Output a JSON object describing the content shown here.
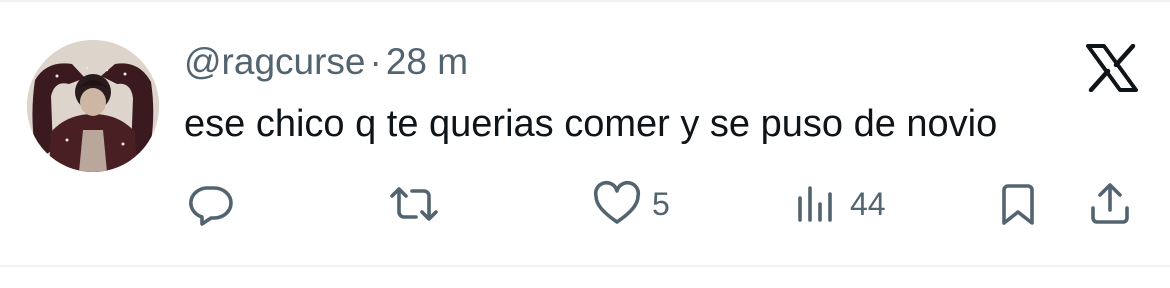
{
  "tweet": {
    "handle": "@ragcurse",
    "separator": "·",
    "time": "28 m",
    "text": "ese chico q te querias comer y se puso de novio"
  },
  "actions": {
    "reply": {
      "icon": "reply-icon"
    },
    "retweet": {
      "icon": "retweet-icon"
    },
    "like": {
      "icon": "heart-icon",
      "count": "5"
    },
    "views": {
      "icon": "views-icon",
      "count": "44"
    },
    "bookmark": {
      "icon": "bookmark-icon"
    },
    "share": {
      "icon": "share-icon"
    }
  },
  "colors": {
    "text_primary": "#0f1419",
    "text_secondary": "#536471",
    "border": "#eff3f4",
    "background": "#ffffff"
  }
}
